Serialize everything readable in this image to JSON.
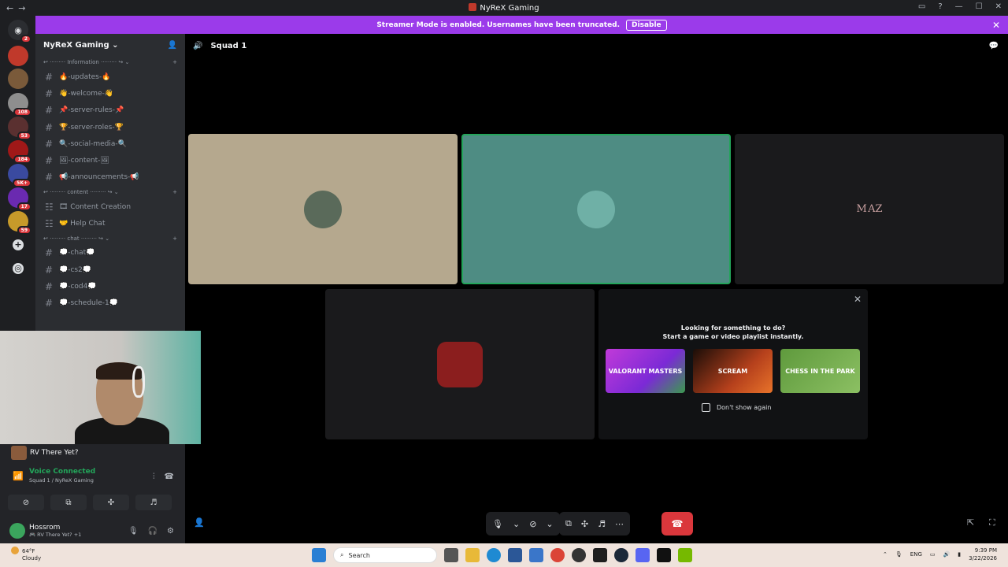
{
  "window": {
    "title": "NyReX Gaming"
  },
  "streamer_banner": {
    "text": "Streamer Mode is enabled. Usernames have been truncated.",
    "button": "Disable"
  },
  "guild_badges": [
    "2",
    "108",
    "53",
    "184",
    "5K+",
    "17",
    "59"
  ],
  "server": {
    "name": "NyReX Gaming"
  },
  "categories": [
    "Information",
    "content",
    "chat"
  ],
  "channels_info": [
    "🔥-updates-🔥",
    "👋-welcome-👋",
    "📌-server-rules-📌",
    "🏆-server-roles-🏆",
    "🔍-social-media-🔍",
    "🖼-content-🖼",
    "📢-announcements-📢"
  ],
  "channels_content": [
    "🎞 Content Creation",
    "🤝 Help Chat"
  ],
  "channels_chat": [
    "💭-chat💭",
    "💭-cs2💭",
    "💭-cod4💭",
    "💭-schedule-1💭"
  ],
  "activity": {
    "game": "RV There Yet?"
  },
  "voice": {
    "status": "Voice Connected",
    "location": "Squad 1 / NyReX Gaming"
  },
  "user": {
    "name": "Hossrom",
    "status": "🎮 RV There Yet? +1"
  },
  "call": {
    "channel": "Squad 1"
  },
  "promo": {
    "line1": "Looking for something to do?",
    "line2": "Start a game or video playlist instantly.",
    "cards": [
      "VALORANT MASTERS",
      "SCREAM",
      "CHESS IN THE PARK"
    ],
    "dont_show": "Don't show again"
  },
  "taskbar": {
    "weather_temp": "64°F",
    "weather_desc": "Cloudy",
    "search": "Search",
    "lang": "ENG",
    "time": "9:39 PM",
    "date": "3/22/2026"
  },
  "colors": {
    "accent": "#9b3bea",
    "green": "#23a55a",
    "red": "#da373c"
  }
}
